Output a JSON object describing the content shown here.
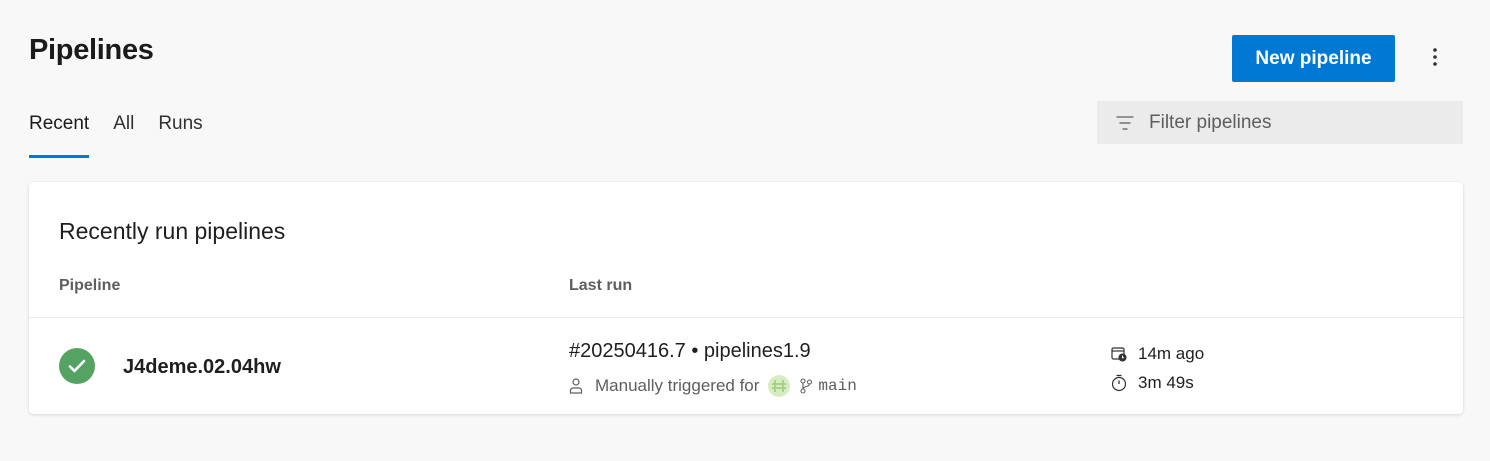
{
  "header": {
    "title": "Pipelines",
    "new_button_label": "New pipeline",
    "more_icon": "more-vertical-icon"
  },
  "tabs": [
    {
      "label": "Recent",
      "selected": true
    },
    {
      "label": "All",
      "selected": false
    },
    {
      "label": "Runs",
      "selected": false
    }
  ],
  "filter": {
    "placeholder": "Filter pipelines",
    "icon": "filter-icon"
  },
  "recent": {
    "title": "Recently run pipelines",
    "columns": {
      "pipeline": "Pipeline",
      "last_run": "Last run"
    },
    "rows": [
      {
        "status": "succeeded",
        "status_icon": "check-circle-icon",
        "name": "J4deme.02.04hw",
        "run_title": "#20250416.7 • pipelines1.9",
        "trigger": "Manually triggered for",
        "branch": "main",
        "time_ago": "14m ago",
        "duration": "3m 49s"
      }
    ]
  },
  "colors": {
    "accent": "#0078d4",
    "success": "#55a362",
    "background": "#f8f8f8",
    "card": "#ffffff",
    "filter_bg": "#ebebeb"
  }
}
